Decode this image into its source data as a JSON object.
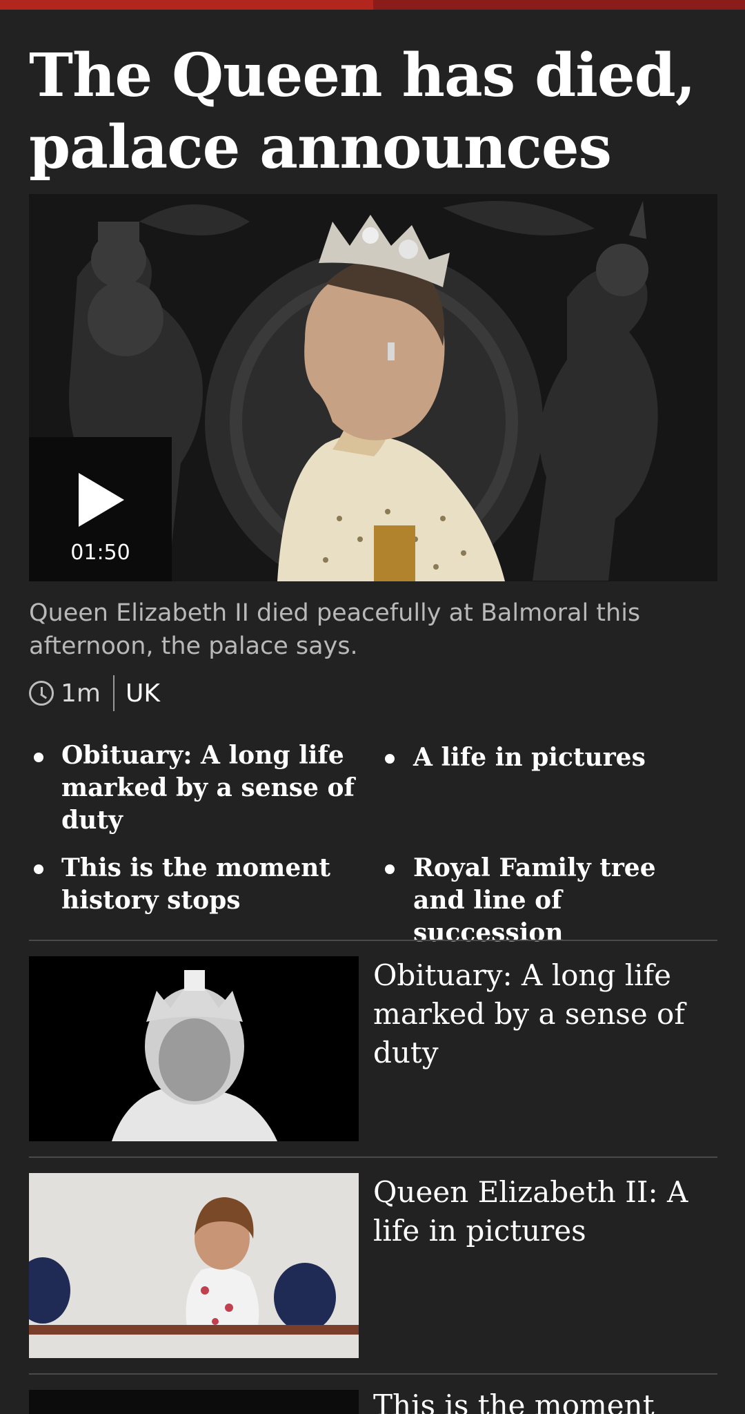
{
  "headline": "The Queen has died, palace announces",
  "hero": {
    "duration": "01:50",
    "image_alt": "Portrait of Queen Elizabeth II in profile wearing a crown, in front of the royal coat of arms"
  },
  "summary": "Queen Elizabeth II died peacefully at Balmoral this afternoon, the palace says.",
  "meta": {
    "time": "1m",
    "section": "UK"
  },
  "related_links": [
    "Obituary: A long life marked by a sense of duty",
    "A life in pictures",
    "This is the moment history stops",
    "Royal Family tree and line of succession"
  ],
  "stories": [
    {
      "title": "Obituary: A long life marked by a sense of duty"
    },
    {
      "title": "Queen Elizabeth II: A life in pictures"
    },
    {
      "title": "This is the moment history stops"
    }
  ],
  "colors": {
    "background": "#222222",
    "accent_red": "#b3261e",
    "text": "#ffffff",
    "summary_text": "#b9b9b9"
  }
}
